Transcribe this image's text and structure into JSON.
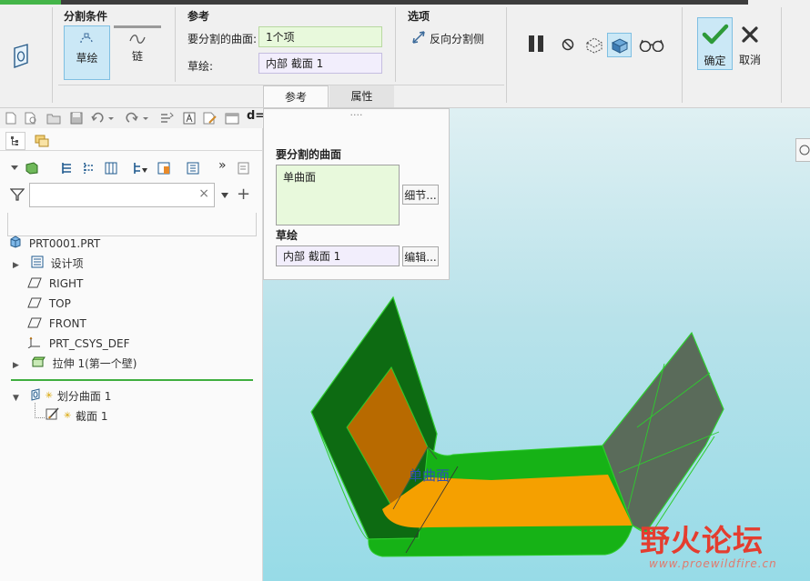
{
  "ribbon": {
    "condition_group": "分割条件",
    "sketch_label": "草绘",
    "chain_label": "链",
    "reference_group": "参考",
    "surface_field_label": "要分割的曲面:",
    "surface_field_value": "1个项",
    "sketch_field_label": "草绘:",
    "sketch_field_value": "内部 截面 1",
    "options_group": "选项",
    "reverse_label": "反向分割侧",
    "ok_label": "确定",
    "cancel_label": "取消",
    "tab_reference": "参考",
    "tab_properties": "属性"
  },
  "toolbar": {
    "partial_text": "d="
  },
  "flyout": {
    "dots": "····",
    "surface_title": "要分割的曲面",
    "surface_item": "单曲面",
    "details_button": "细节...",
    "sketch_title": "草绘",
    "sketch_value": "内部 截面 1",
    "edit_button": "编辑..."
  },
  "model_tree": {
    "root": "PRT0001.PRT",
    "items": [
      {
        "label": "设计项",
        "icon": "design-items-icon"
      },
      {
        "label": "RIGHT",
        "icon": "datum-plane-icon"
      },
      {
        "label": "TOP",
        "icon": "datum-plane-icon"
      },
      {
        "label": "FRONT",
        "icon": "datum-plane-icon"
      },
      {
        "label": "PRT_CSYS_DEF",
        "icon": "csys-icon"
      },
      {
        "label": "拉伸 1(第一个壁)",
        "icon": "extrude-icon"
      }
    ],
    "split_feature": "划分曲面 1",
    "split_child": "截面 1"
  },
  "viewport": {
    "surface_annotation": "单曲面"
  },
  "watermark": {
    "title": "野火论坛",
    "url": "www.proewildfire.cn"
  },
  "colors": {
    "accent_green": "#44b549",
    "selection_blue": "#cbe8f6",
    "field_green": "#e8f9dc",
    "field_lavender": "#f2eefc",
    "model_dark_green": "#0d6b12",
    "model_green": "#16b216",
    "model_orange": "#f5a000"
  }
}
